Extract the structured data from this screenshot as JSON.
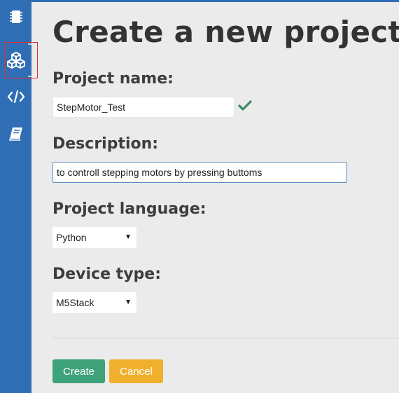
{
  "page": {
    "title": "Create a new project"
  },
  "sidebar": {
    "items": [
      {
        "icon": "chip-icon"
      },
      {
        "icon": "blocks-icon",
        "active": true
      },
      {
        "icon": "code-icon"
      },
      {
        "icon": "book-icon"
      }
    ]
  },
  "form": {
    "project_name": {
      "label": "Project name:",
      "value": "StepMotor_Test",
      "valid_icon": "checkmark-icon"
    },
    "description": {
      "label": "Description:",
      "value": "to controll stepping motors by pressing buttoms"
    },
    "language": {
      "label": "Project language:",
      "selected": "Python"
    },
    "device": {
      "label": "Device type:",
      "selected": "M5Stack"
    }
  },
  "actions": {
    "create_label": "Create",
    "cancel_label": "Cancel"
  },
  "colors": {
    "sidebar": "#2f6db5",
    "create": "#3ea27a",
    "cancel": "#f0b02e",
    "check": "#3e8a66"
  }
}
